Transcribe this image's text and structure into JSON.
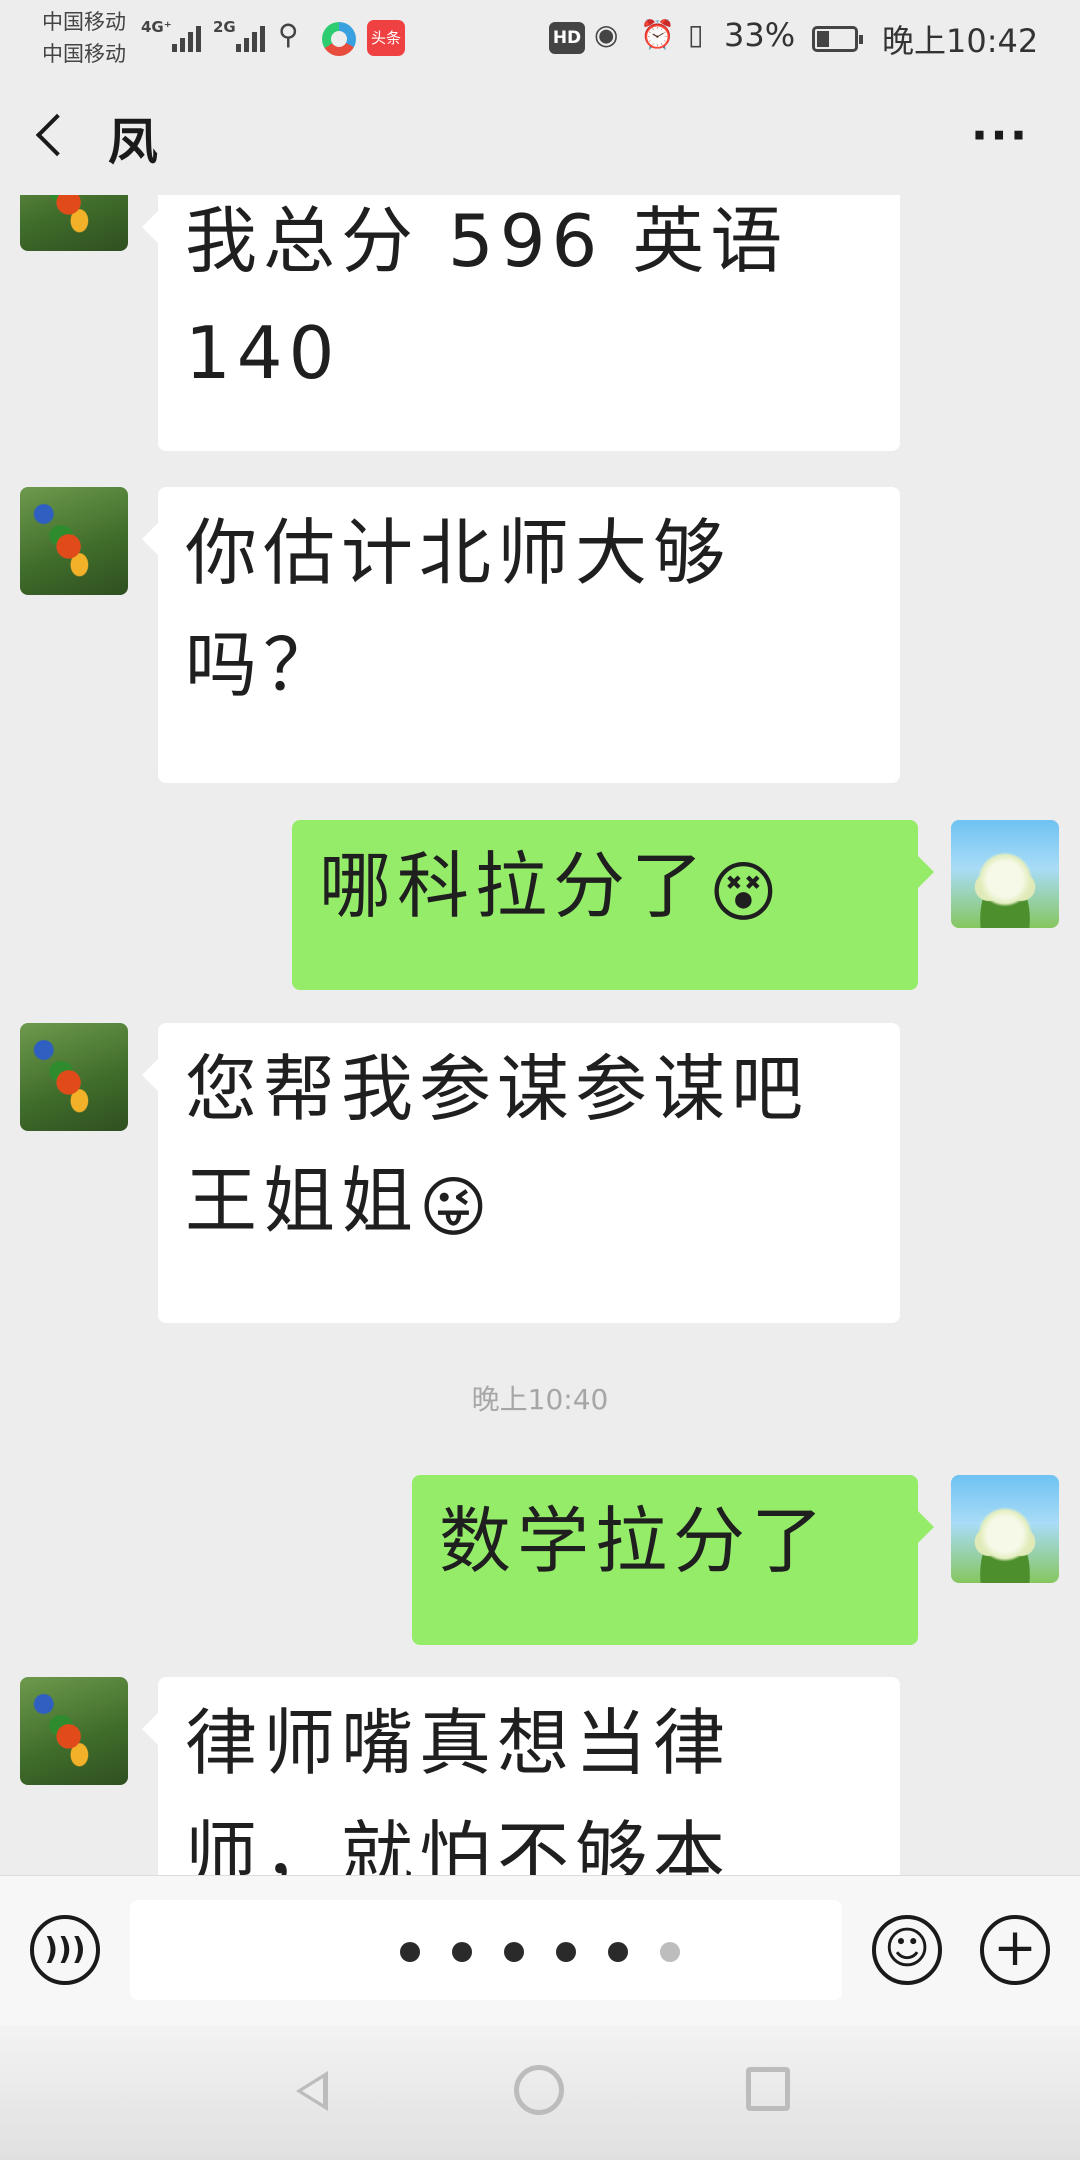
{
  "status_bar": {
    "carrier_1": "中国移动",
    "carrier_2": "中国移动",
    "network_1": "4G⁺",
    "network_2": "2G",
    "news_app_label": "头条",
    "hd_label": "HD",
    "battery_percent": "33%",
    "battery_level": 0.33,
    "time": "晚上10:42"
  },
  "header": {
    "title": "凤",
    "more_label": "···",
    "back_icon": "chevron-left-icon"
  },
  "messages": [
    {
      "side": "left",
      "text": "我总分 596 英语 140"
    },
    {
      "side": "left",
      "text": "你估计北师大够吗？"
    },
    {
      "side": "right",
      "text": "哪科拉分了",
      "emoji": "😵"
    },
    {
      "side": "left",
      "text": "您帮我参谋参谋吧王姐姐",
      "emoji": "😜"
    },
    {
      "side": "right",
      "text": "数学拉分了"
    },
    {
      "side": "left",
      "text": "律师嘴真想当律师，就怕不够本"
    }
  ],
  "time_divider": "晚上10:40",
  "input_bar": {
    "voice_icon": "voice-icon",
    "emoji_icon": "smile-icon",
    "plus_icon": "plus-icon",
    "page_dots": 6,
    "active_dot": 6
  },
  "nav_bar": {
    "back_icon": "triangle-back-icon",
    "home_icon": "circle-home-icon",
    "recent_icon": "square-recent-icon"
  }
}
